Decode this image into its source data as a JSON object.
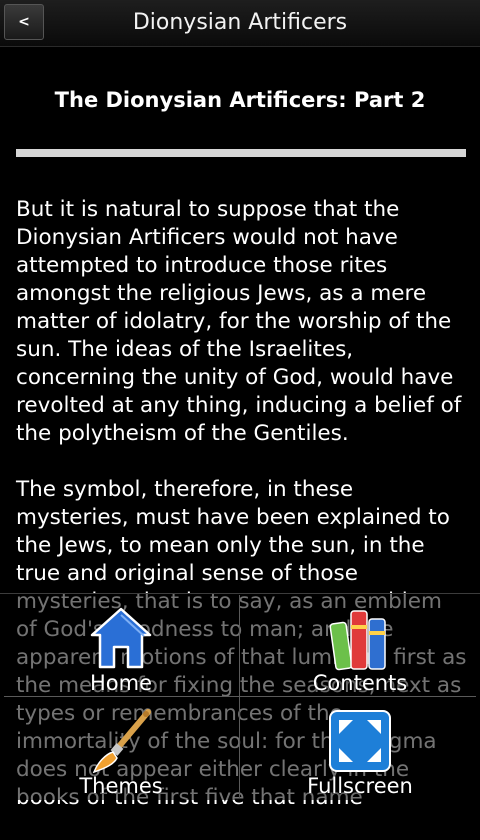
{
  "titlebar": {
    "back_label": "<",
    "title": "Dionysian Artificers"
  },
  "chapter": {
    "title": "The Dionysian Artificers: Part 2"
  },
  "content": {
    "paragraphs": [
      "But it is natural to suppose that the Dionysian Artificers would not have attempted to introduce those rites amongst the religious Jews, as a mere matter of idolatry, for the worship of the sun. The ideas of the Israelites, concerning the unity of God, would have revolted at any thing, inducing a belief of the polytheism of the Gentiles.",
      "The symbol, therefore, in these mysteries, must have been explained to the Jews, to mean only the sun, in the true and original sense of those mysteries, that is to say, as an emblem of God's goodness to man; and the apparent motions of that luminary first as the means for fixing the seasons, next as types or remembrances of the immortality of the soul: for that dogma does not appear either clearly in the books of the first five that name"
    ]
  },
  "menu": {
    "items": [
      {
        "label": "Home",
        "icon": "house-icon"
      },
      {
        "label": "Contents",
        "icon": "books-icon"
      },
      {
        "label": "Themes",
        "icon": "paintbrush-icon"
      },
      {
        "label": "Fullscreen",
        "icon": "fullscreen-icon"
      }
    ]
  },
  "colors": {
    "background": "#000000",
    "text": "#ffffff",
    "home_icon": "#2a6fd6",
    "fullscreen_icon": "#1e7fd8"
  }
}
